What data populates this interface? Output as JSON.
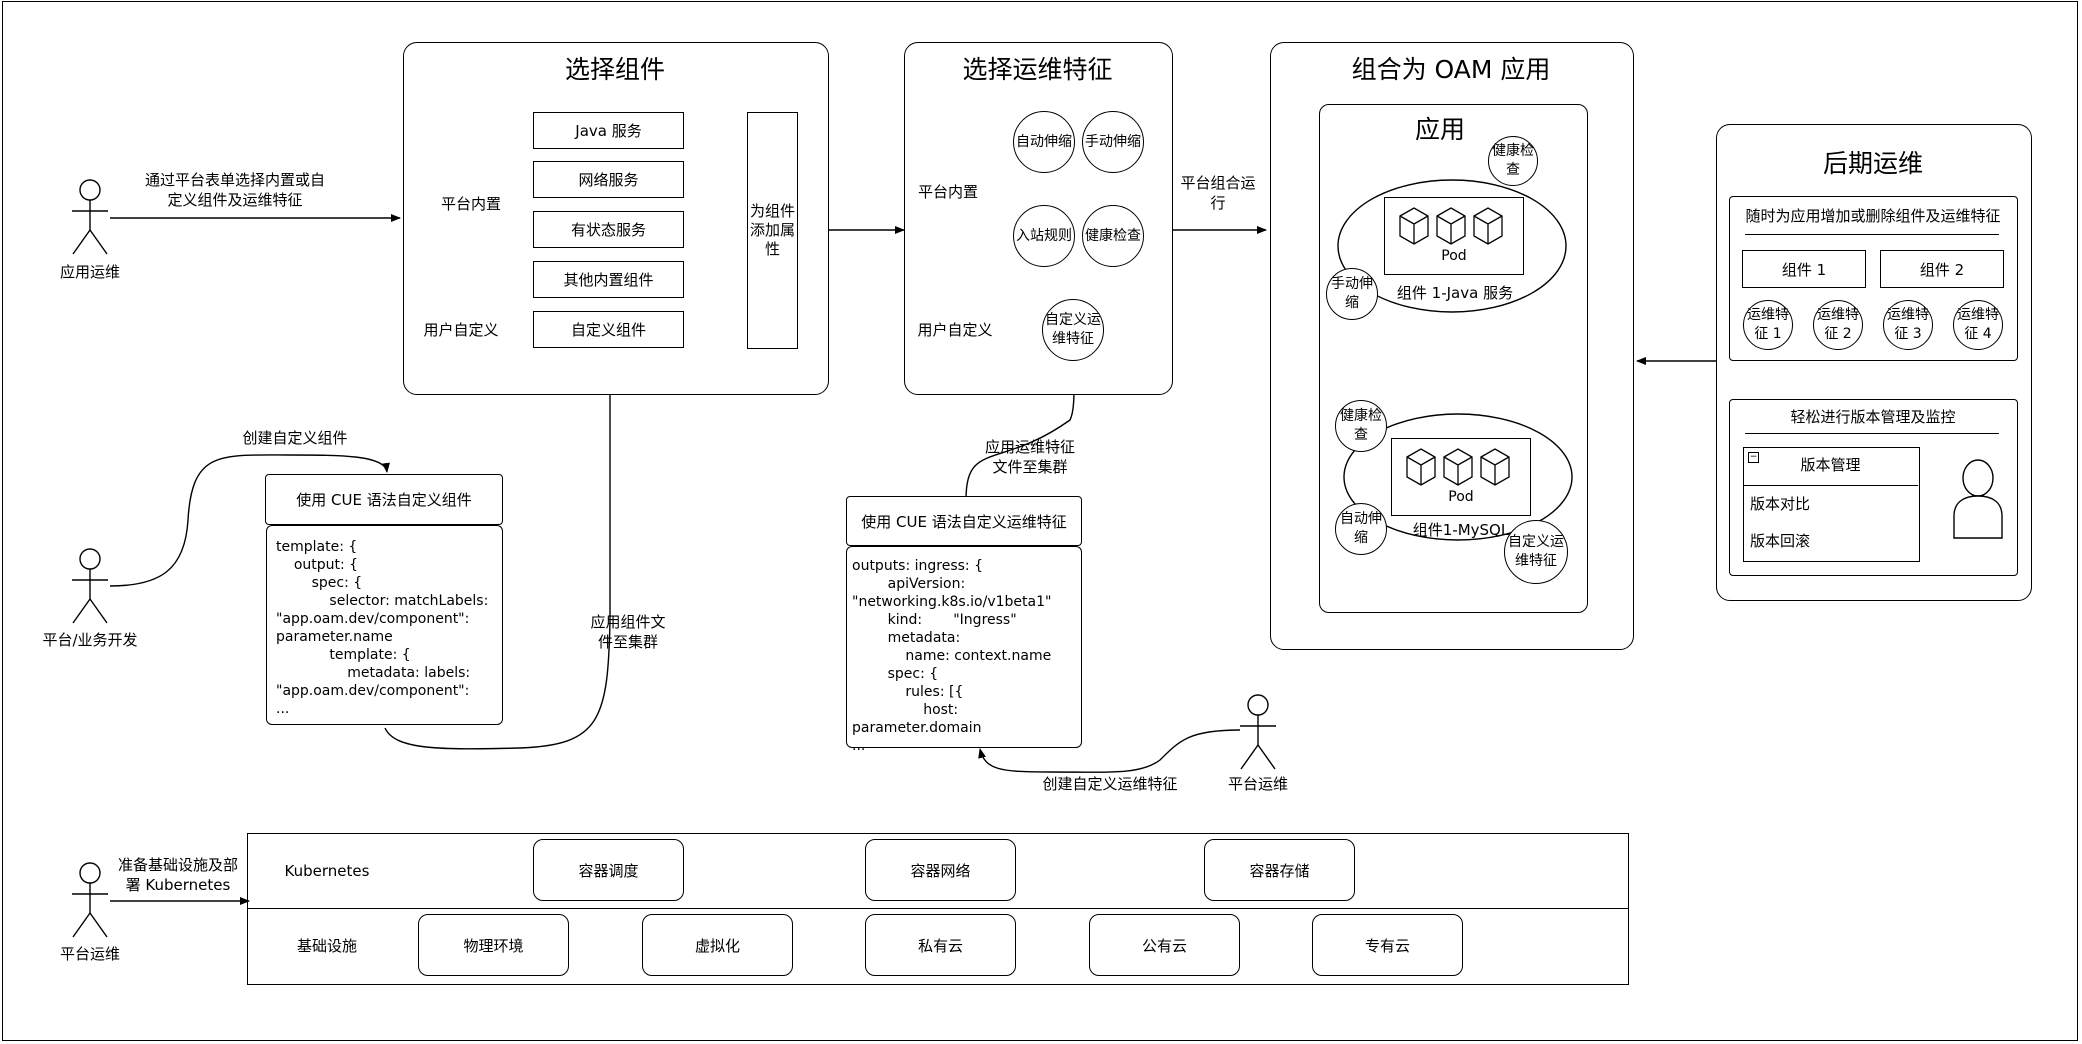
{
  "panels": {
    "select_components": {
      "title": "选择组件",
      "group_builtin": "平台内置",
      "group_custom": "用户自定义",
      "items": [
        "Java 服务",
        "网络服务",
        "有状态服务",
        "其他内置组件"
      ],
      "custom_item": "自定义组件",
      "attach_attr": "为组件添加属性"
    },
    "select_traits": {
      "title": "选择运维特征",
      "group_builtin": "平台内置",
      "group_custom": "用户自定义",
      "traits": [
        "自动伸缩",
        "手动伸缩",
        "入站规则",
        "健康检查"
      ],
      "custom_trait": "自定义运维特征"
    },
    "compose_app": {
      "title": "组合为 OAM 应用",
      "inner_title": "应用",
      "component1": {
        "pod": "Pod",
        "label": "组件 1-Java 服务",
        "trait_health": "健康检查",
        "trait_manual": "手动伸缩"
      },
      "component2": {
        "pod": "Pod",
        "label": "组件1-MySQL",
        "trait_health": "健康检查",
        "trait_auto": "自动伸缩",
        "trait_custom": "自定义运维特征"
      }
    },
    "later_ops": {
      "title": "后期运维",
      "section1_title": "随时为应用增加或删除组件及运维特征",
      "components": [
        "组件 1",
        "组件 2"
      ],
      "traits": [
        "运维特征 1",
        "运维特征 2",
        "运维特征 3",
        "运维特征 4"
      ],
      "section2_title": "轻松进行版本管理及监控",
      "version_header": "版本管理",
      "version_items": [
        "版本对比",
        "版本回滚"
      ]
    }
  },
  "actors": {
    "app_ops": "应用运维",
    "platform_dev": "平台/业务开发",
    "platform_ops_mid": "平台运维",
    "platform_ops_bottom": "平台运维"
  },
  "edges": {
    "app_ops_to_components": "通过平台表单选择内置或自定义组件及运维特征",
    "compose_run": "平台组合运行",
    "create_custom_component": "创建自定义组件",
    "apply_component_file": "应用组件文件至集群",
    "apply_trait_file": "应用运维特征文件至集群",
    "create_custom_trait": "创建自定义运维特征",
    "prepare_infra": "准备基础设施及部署 Kubernetes"
  },
  "cue_component": {
    "header": "使用 CUE 语法自定义组件",
    "lines": [
      "template: {",
      "    output: {",
      "        spec: {",
      "            selector: matchLabels:",
      "\"app.oam.dev/component\":",
      "parameter.name",
      "            template: {",
      "                metadata: labels:",
      "\"app.oam.dev/component\":",
      "..."
    ]
  },
  "cue_trait": {
    "header": "使用 CUE 语法自定义运维特征",
    "lines": [
      "outputs: ingress: {",
      "        apiVersion:",
      "\"networking.k8s.io/v1beta1\"",
      "        kind:       \"Ingress\"",
      "        metadata:",
      "            name: context.name",
      "        spec: {",
      "            rules: [{",
      "                host: parameter.domain",
      "..."
    ]
  },
  "infra": {
    "kubernetes_label": "Kubernetes",
    "kubernetes_items": [
      "容器调度",
      "容器网络",
      "容器存储"
    ],
    "infra_label": "基础设施",
    "infra_items": [
      "物理环境",
      "虚拟化",
      "私有云",
      "公有云",
      "专有云"
    ]
  }
}
